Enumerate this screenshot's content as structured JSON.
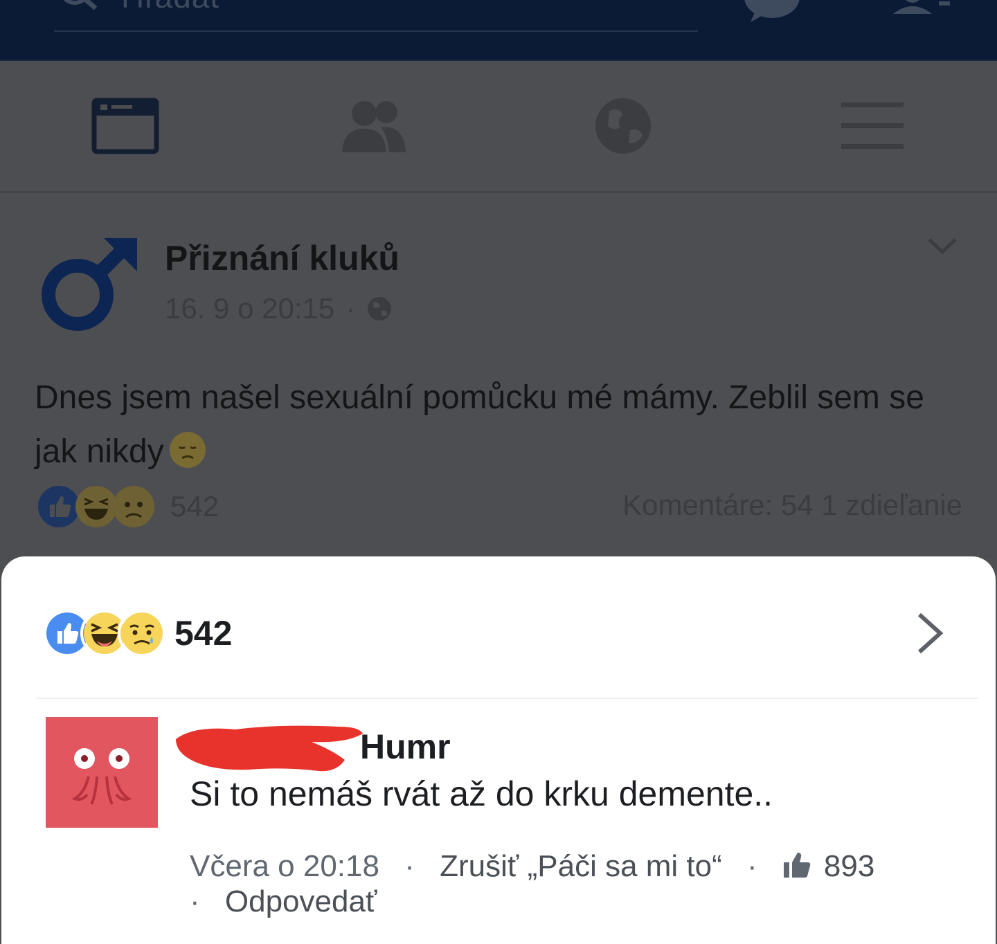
{
  "search": {
    "placeholder": "Hľadať"
  },
  "icons": {
    "search": "search-icon",
    "messenger": "messenger-icon",
    "friend_requests": "friend-requests-icon",
    "feed": "news-feed-icon",
    "friends": "friends-icon",
    "globe": "globe-icon",
    "menu": "menu-icon"
  },
  "post": {
    "author": "Přiznání kluků",
    "timestamp": "16. 9 o 20:15",
    "meta_separator": "·",
    "text": "Dnes jsem našel sexuální pomůcku mé mámy. Zeblil sem se jak nikdy",
    "reaction_count": "542",
    "comments_shares": "Komentáre: 54  1 zdieľanie"
  },
  "sheet": {
    "reaction_count": "542",
    "comment": {
      "author": "Humr",
      "text": "Si to nemáš rvát až do krku demente..",
      "timestamp": "Včera o 20:18",
      "separator": "·",
      "unlike_label": "Zrušiť „Páči sa mi to“",
      "like_count": "893",
      "reply_label": "Odpovedať"
    }
  },
  "colors": {
    "top_bar": "#0b1a35",
    "dim_overlay": "#4d4e51",
    "like_blue": "#4a8cf0",
    "emoji_yellow": "#f7d55a",
    "avatar_red": "#e25660",
    "redaction_red": "#e8322c"
  }
}
